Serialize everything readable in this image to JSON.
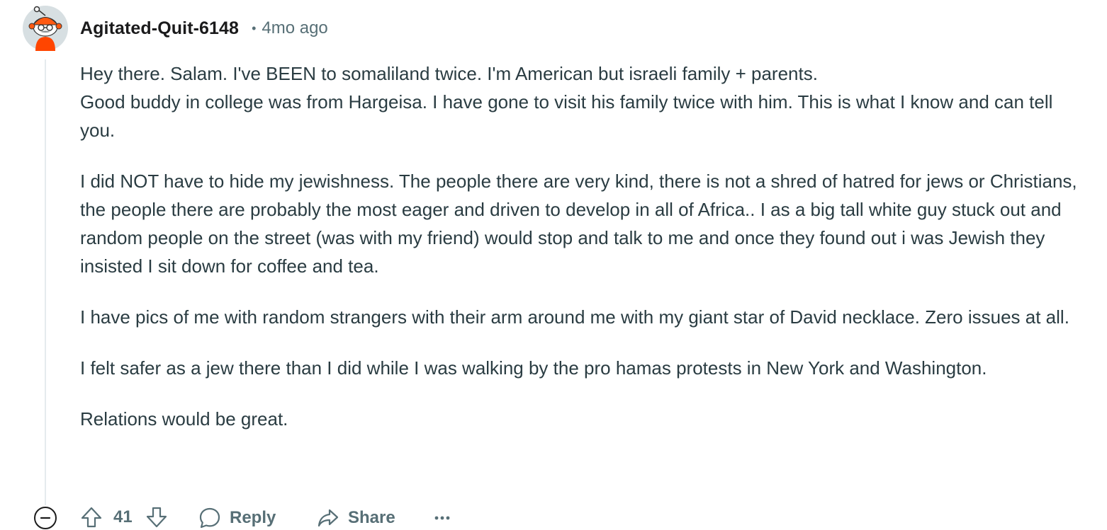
{
  "comment": {
    "author": "Agitated-Quit-6148",
    "separator": "•",
    "timestamp": "4mo ago",
    "avatar_icon": "snoo-avatar-icon",
    "paragraphs": [
      "Hey there. Salam. I've BEEN to somaliland twice. I'm American but israeli family + parents.\nGood buddy in college was from Hargeisa. I have gone to visit his family twice with him. This is what I know and can tell you.",
      "I did NOT have to hide my jewishness. The people there are very kind, there is not a shred of hatred for jews or Christians, the people there are probably the most eager and driven to develop in all of Africa.. I as a big tall white guy stuck out and random people on the street (was with my friend) would stop and talk to me and once they found out i was Jewish they insisted I sit down for coffee and tea.",
      "I have pics of me with random strangers with their arm around me with my giant star of David necklace. Zero issues at all.",
      "I felt safer as a jew there than I did while I was walking by the pro hamas protests in New York and Washington.",
      "Relations would be great."
    ]
  },
  "actions": {
    "collapse_icon": "collapse-minus-icon",
    "upvote_icon": "upvote-arrow-icon",
    "vote_count": "41",
    "downvote_icon": "downvote-arrow-icon",
    "reply_icon": "speech-bubble-icon",
    "reply_label": "Reply",
    "share_icon": "share-arrow-icon",
    "share_label": "Share",
    "more_icon": "ellipsis-icon"
  },
  "colors": {
    "text_primary": "#2a3c42",
    "text_secondary": "#576f76",
    "thread_line": "#e5ebee",
    "avatar_accent": "#ff4500"
  }
}
